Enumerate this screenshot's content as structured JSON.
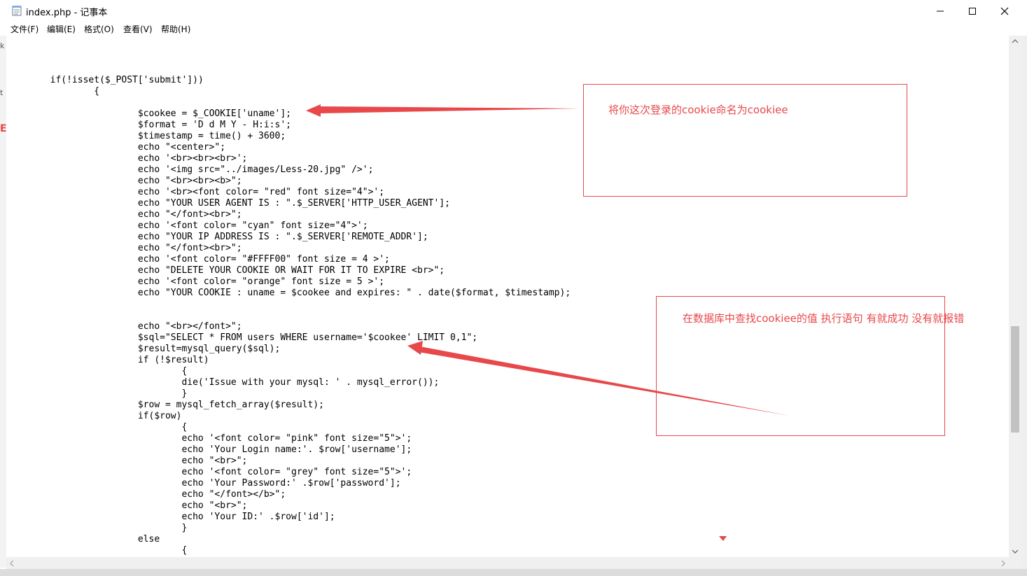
{
  "window": {
    "title": "index.php - 记事本",
    "controls": {
      "minimize": "minimize-icon",
      "maximize": "maximize-icon",
      "close": "close-icon"
    }
  },
  "menu": [
    {
      "label": "文件(F)"
    },
    {
      "label": "编辑(E)"
    },
    {
      "label": "格式(O)"
    },
    {
      "label": "查看(V)"
    },
    {
      "label": "帮助(H)"
    }
  ],
  "code_lines": [
    "",
    "",
    "\tif(!isset($_POST['submit']))",
    "\t\t{",
    "",
    "\t\t\t$cookee = $_COOKIE['uname'];",
    "\t\t\t$format = 'D d M Y - H:i:s';",
    "\t\t\t$timestamp = time() + 3600;",
    "\t\t\techo \"<center>\";",
    "\t\t\techo '<br><br><br>';",
    "\t\t\techo '<img src=\"../images/Less-20.jpg\" />';",
    "\t\t\techo \"<br><br><b>\";",
    "\t\t\techo '<br><font color= \"red\" font size=\"4\">';",
    "\t\t\techo \"YOUR USER AGENT IS : \".$_SERVER['HTTP_USER_AGENT'];",
    "\t\t\techo \"</font><br>\";",
    "\t\t\techo '<font color= \"cyan\" font size=\"4\">';",
    "\t\t\techo \"YOUR IP ADDRESS IS : \".$_SERVER['REMOTE_ADDR'];",
    "\t\t\techo \"</font><br>\";",
    "\t\t\techo '<font color= \"#FFFF00\" font size = 4 >';",
    "\t\t\techo \"DELETE YOUR COOKIE OR WAIT FOR IT TO EXPIRE <br>\";",
    "\t\t\techo '<font color= \"orange\" font size = 5 >';",
    "\t\t\techo \"YOUR COOKIE : uname = $cookee and expires: \" . date($format, $timestamp);",
    "",
    "",
    "\t\t\techo \"<br></font>\";",
    "\t\t\t$sql=\"SELECT * FROM users WHERE username='$cookee' LIMIT 0,1\";",
    "\t\t\t$result=mysql_query($sql);",
    "\t\t\tif (!$result)",
    "\t\t\t\t{",
    "\t\t\t\tdie('Issue with your mysql: ' . mysql_error());",
    "\t\t\t\t}",
    "\t\t\t$row = mysql_fetch_array($result);",
    "\t\t\tif($row)",
    "\t\t\t\t{",
    "\t\t\t\techo '<font color= \"pink\" font size=\"5\">';",
    "\t\t\t\techo 'Your Login name:'. $row['username'];",
    "\t\t\t\techo \"<br>\";",
    "\t\t\t\techo '<font color= \"grey\" font size=\"5\">';",
    "\t\t\t\techo 'Your Password:' .$row['password'];",
    "\t\t\t\techo \"</font></b>\";",
    "\t\t\t\techo \"<br>\";",
    "\t\t\t\techo 'Your ID:' .$row['id'];",
    "\t\t\t\t}",
    "\t\t\telse",
    "\t\t\t\t{"
  ],
  "annotations": [
    {
      "text": "将你这次登录的cookie命名为cookiee",
      "color": "#e8484a"
    },
    {
      "text": "在数据库中查找cookiee的值 执行语句 有就成功 没有就报错",
      "color": "#e8484a"
    }
  ],
  "left_strip_fragments": [
    "k",
    "E",
    "t"
  ]
}
